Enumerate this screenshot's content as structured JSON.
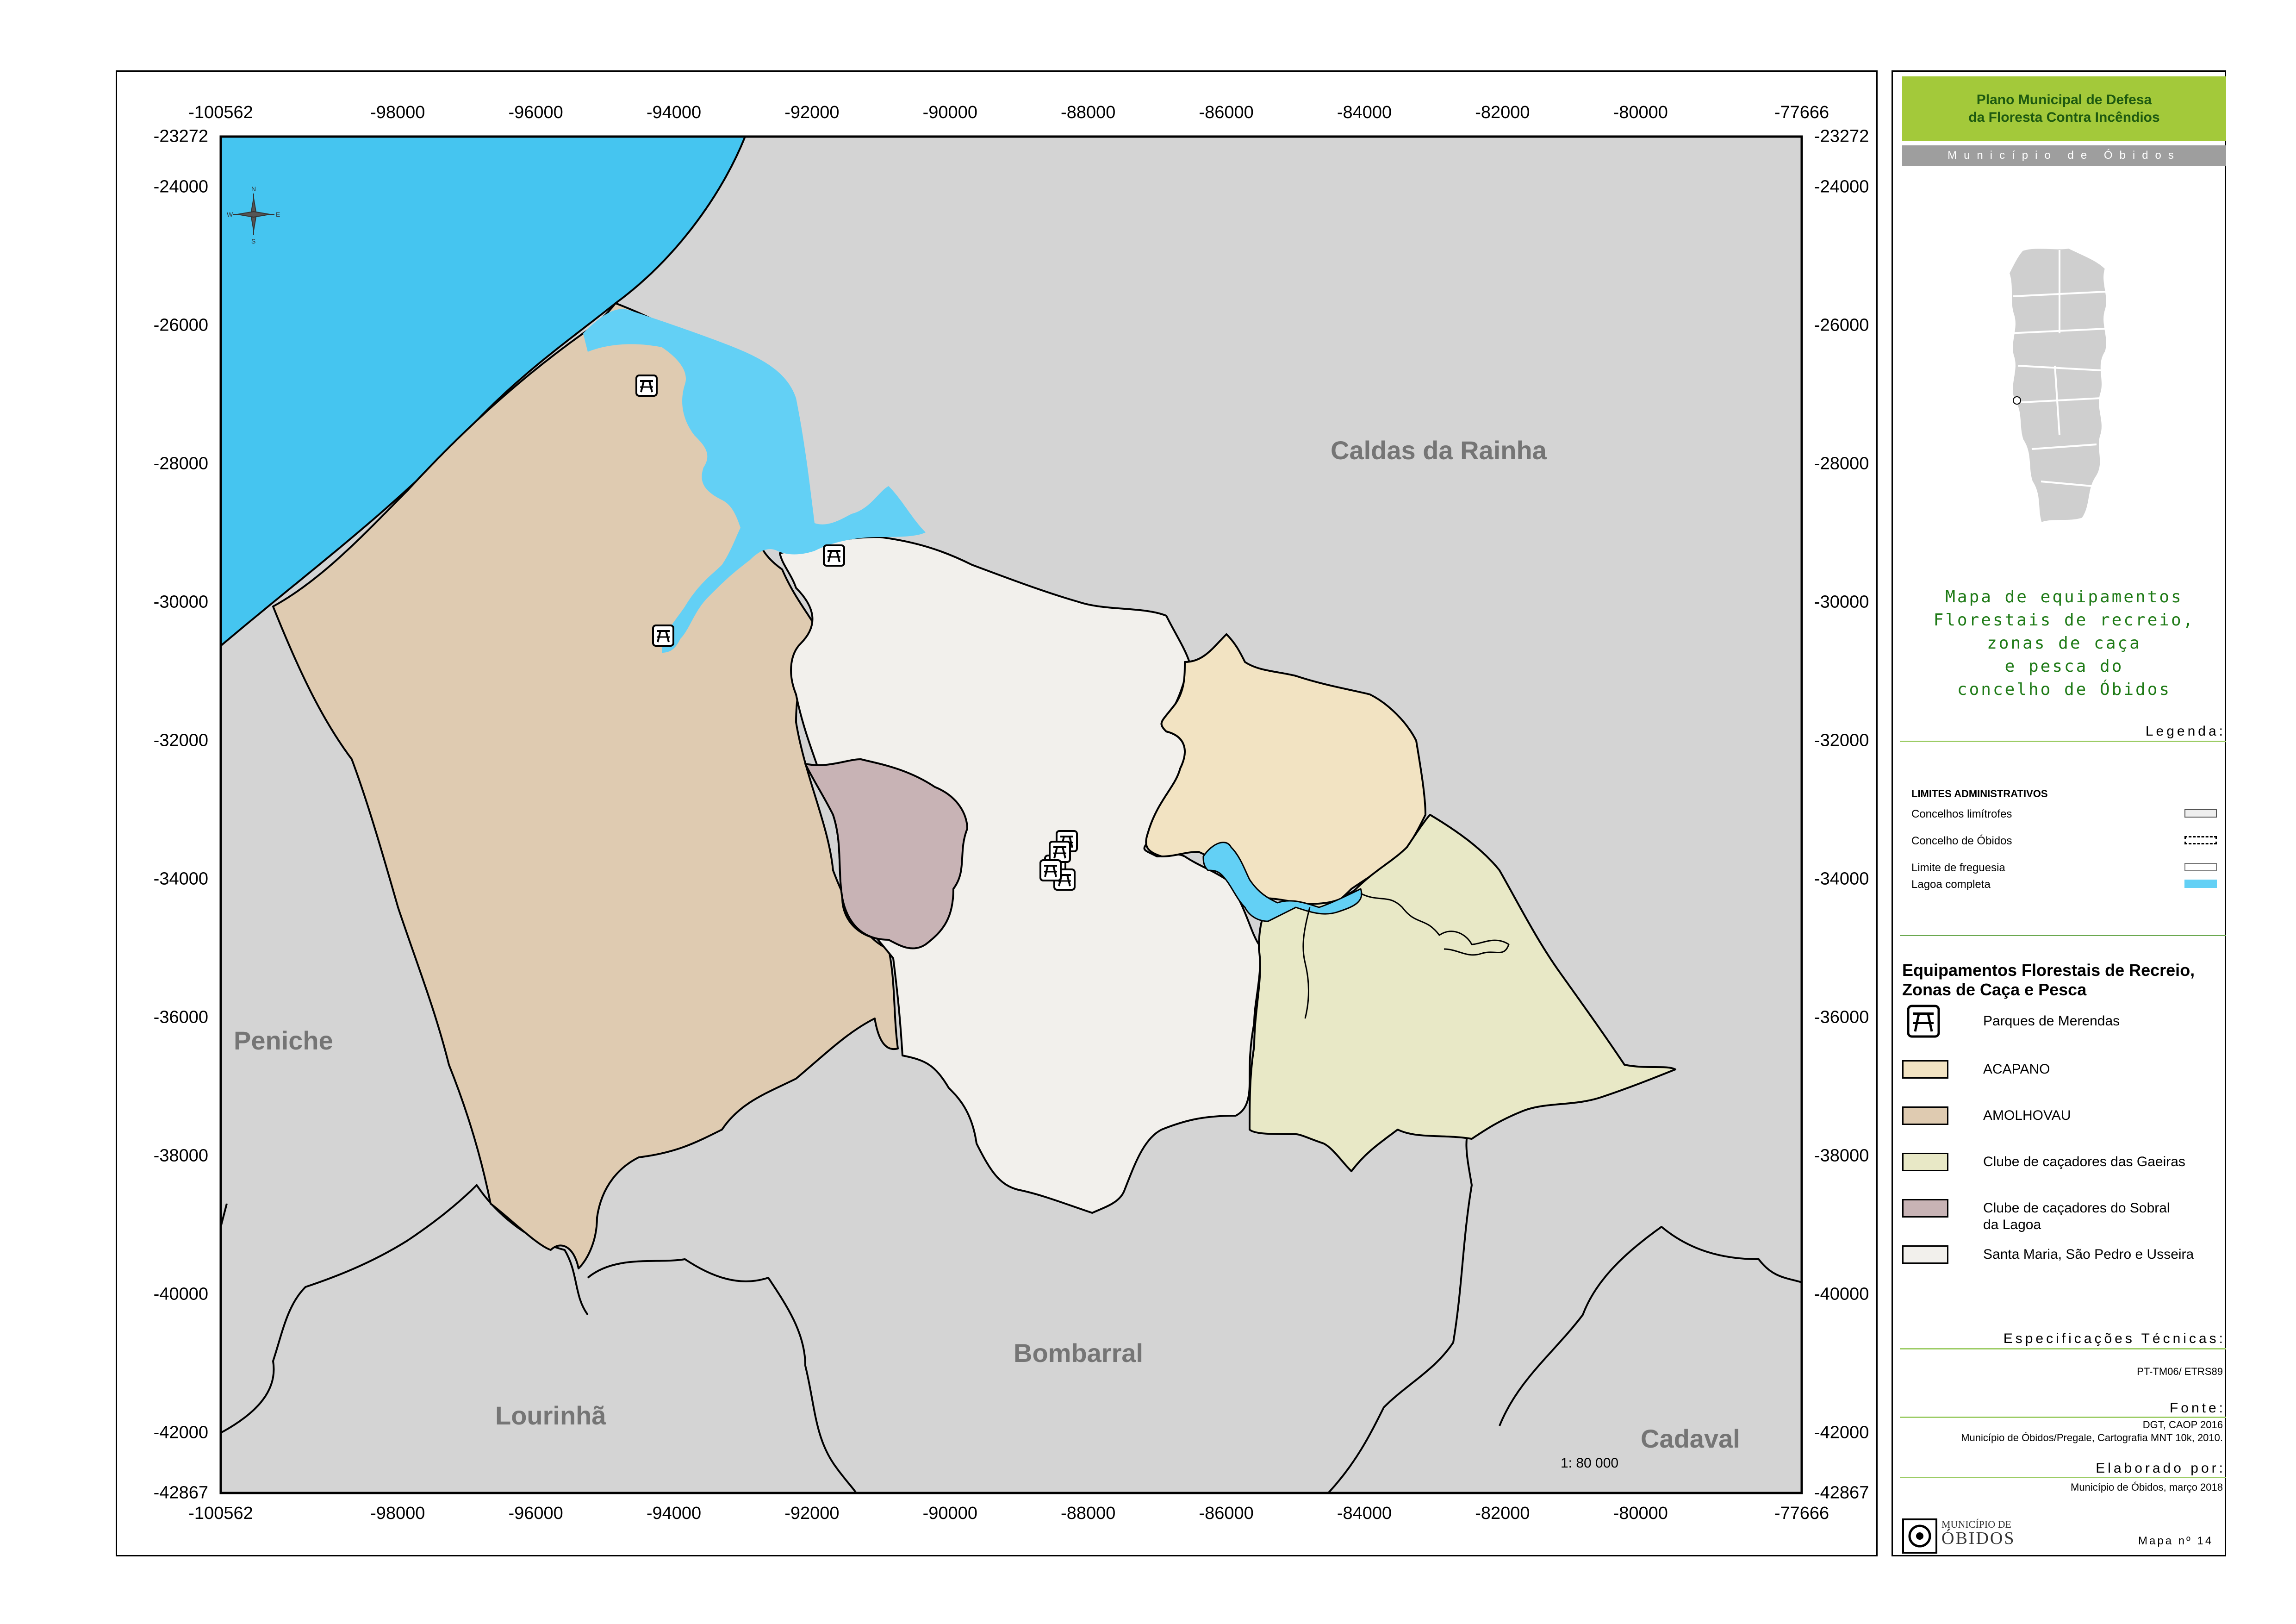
{
  "header": {
    "plan_line1": "Plano Municipal de Defesa",
    "plan_line2": "da Floresta Contra Incêndios",
    "municipio": "Município de Óbidos"
  },
  "map": {
    "x_ticks": [
      "-100562",
      "-98000",
      "-96000",
      "-94000",
      "-92000",
      "-90000",
      "-88000",
      "-86000",
      "-84000",
      "-82000",
      "-80000",
      "-77666"
    ],
    "y_ticks": [
      "-23272",
      "-24000",
      "-26000",
      "-28000",
      "-30000",
      "-32000",
      "-34000",
      "-36000",
      "-38000",
      "-40000",
      "-42000",
      "-42867"
    ],
    "places": {
      "caldas": "Caldas da Rainha",
      "peniche": "Peniche",
      "lourinha": "Lourinhã",
      "bombarral": "Bombarral",
      "cadaval": "Cadaval"
    },
    "scale": "1: 80 000",
    "colors": {
      "sea": "#45c5f0",
      "lagoon": "#63d0f5",
      "neighbors": "#d4d4d4",
      "amolhovau": "#dfcbb1",
      "acapano": "#f2e3c2",
      "gaeiras": "#e8e8c6",
      "sobral": "#c8b3b5",
      "santa_maria": "#f2f0ec"
    },
    "north_arrow_icon": "compass-rose-icon",
    "picnic_icon": "picnic-table-icon"
  },
  "panel": {
    "title_lines": [
      "Mapa de equipamentos",
      "Florestais de recreio,",
      "zonas de caça",
      "e pesca do",
      "concelho de Óbidos"
    ],
    "legenda": "Legenda:",
    "limites_title": "LIMITES ADMINISTRATIVOS",
    "limites": [
      "Concelhos limítrofes",
      "Concelho de Óbidos",
      "Limite de freguesia",
      "Lagoa completa"
    ],
    "equip_title_1": "Equipamentos Florestais de Recreio,",
    "equip_title_2": "Zonas de Caça e Pesca",
    "legend_items": [
      "Parques de Merendas",
      "ACAPANO",
      "AMOLHOVAU",
      "Clube de caçadores das Gaeiras",
      "Clube de caçadores do Sobral da Lagoa",
      "Santa Maria, São Pedro e Usseira"
    ],
    "especificacoes": "Especificações Técnicas:",
    "spec_value": "PT-TM06/ ETRS89",
    "fonte": "Fonte:",
    "fonte_line1": "DGT, CAOP 2016",
    "fonte_line2": "Município de Óbidos/Pregale, Cartografia MNT 10k, 2010.",
    "elaborado": "Elaborado por:",
    "elaborado_value": "Município de Óbidos, março 2018",
    "logo_line1": "MUNICÍPIO DE",
    "logo_line2": "ÓBIDOS",
    "mapa_num": "Mapa nº 14"
  }
}
